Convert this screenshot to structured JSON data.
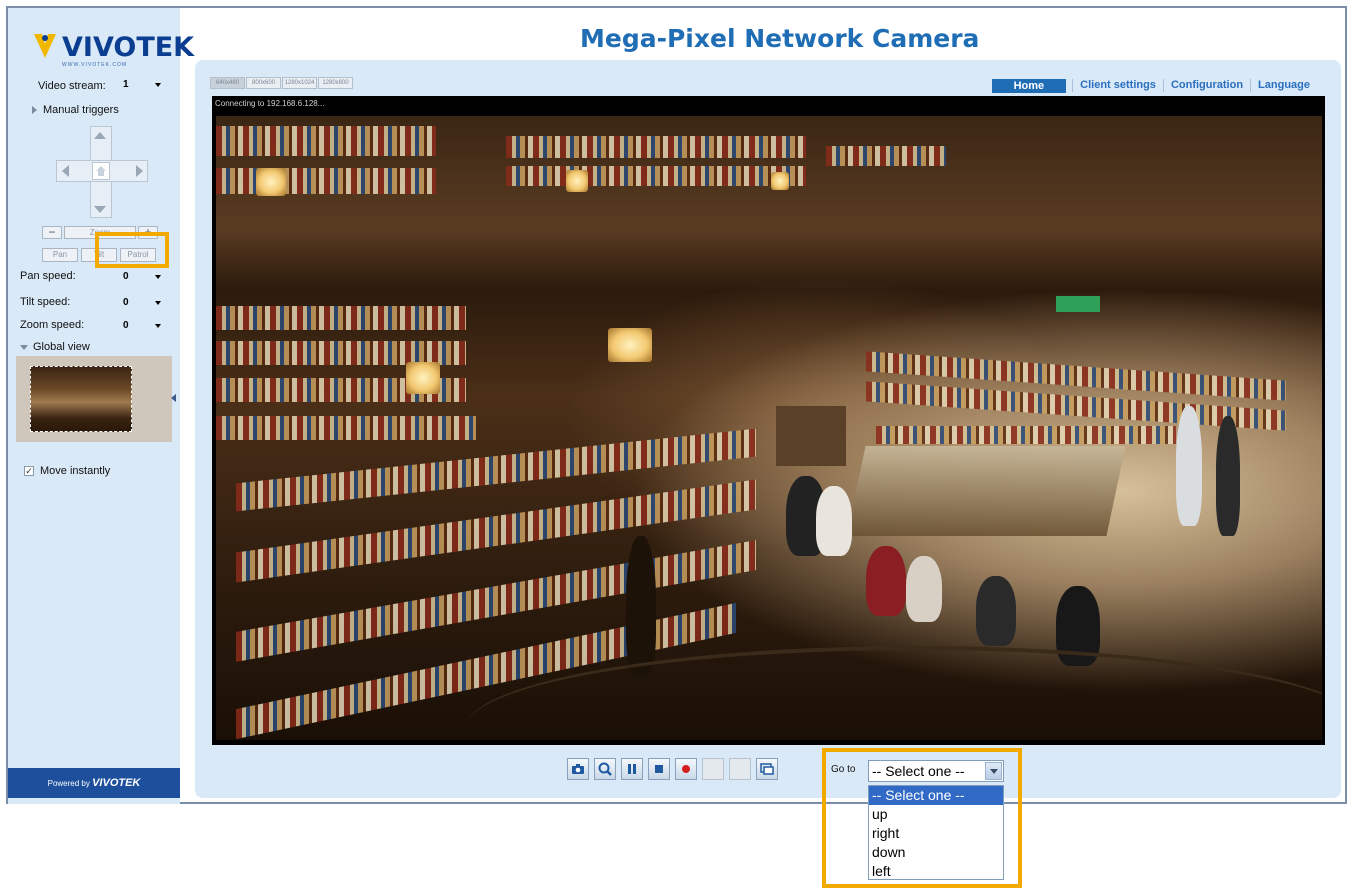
{
  "logo": {
    "word": "VIVOTEK",
    "sub": "WWW.VIVOTEK.COM"
  },
  "header": {
    "title": "Mega-Pixel Network Camera"
  },
  "nav": {
    "home": "Home",
    "client_settings": "Client settings",
    "configuration": "Configuration",
    "language": "Language"
  },
  "sidebar": {
    "video_stream_label": "Video stream:",
    "video_stream_value": "1",
    "manual_triggers_label": "Manual triggers",
    "zoom_label": "Zoom",
    "pan_button": "Pan",
    "tilt_button": "Tilt",
    "patrol_button": "Patrol",
    "pan_speed_label": "Pan speed:",
    "pan_speed_value": "0",
    "tilt_speed_label": "Tilt speed:",
    "tilt_speed_value": "0",
    "zoom_speed_label": "Zoom speed:",
    "zoom_speed_value": "0",
    "global_view_label": "Global view",
    "move_instantly_label": "Move instantly",
    "move_instantly_checked": true,
    "powered_by": "Powered by",
    "powered_brand": "VIVOTEK"
  },
  "stream_tabs": [
    "640x480",
    "800x600",
    "1280x1024",
    "1280x800"
  ],
  "video": {
    "status": "Connecting to 192.168.6.128..."
  },
  "toolbar": {
    "buttons": [
      "snapshot-icon",
      "digital-zoom-icon",
      "pause-icon",
      "stop-icon",
      "record-icon",
      "mute-icon",
      "volume-icon",
      "fullscreen-icon"
    ]
  },
  "goto": {
    "label": "Go to",
    "selected": "-- Select one --",
    "options": [
      "-- Select one --",
      "up",
      "right",
      "down",
      "left"
    ]
  },
  "colors": {
    "accent": "#1f6db5",
    "highlight": "#f2a900",
    "panel": "#d9e9f7"
  }
}
